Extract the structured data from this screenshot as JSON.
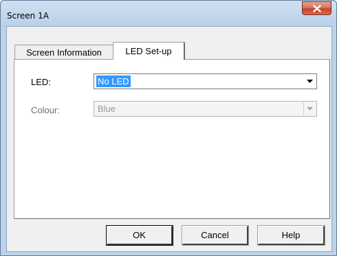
{
  "window": {
    "title": "Screen 1A"
  },
  "tabs": [
    {
      "label": "Screen Information",
      "active": false
    },
    {
      "label": "LED Set-up",
      "active": true
    }
  ],
  "form": {
    "led_label": "LED:",
    "led_value": "No LED",
    "colour_label": "Colour:",
    "colour_value": "Blue",
    "colour_enabled": false
  },
  "buttons": {
    "ok": "OK",
    "cancel": "Cancel",
    "help": "Help"
  },
  "icons": {
    "close": "close-icon",
    "dropdown": "chevron-down-icon"
  },
  "colors": {
    "selection": "#3399ff",
    "close_button": "#c4432a",
    "title_bar": "#bcd3ea"
  }
}
